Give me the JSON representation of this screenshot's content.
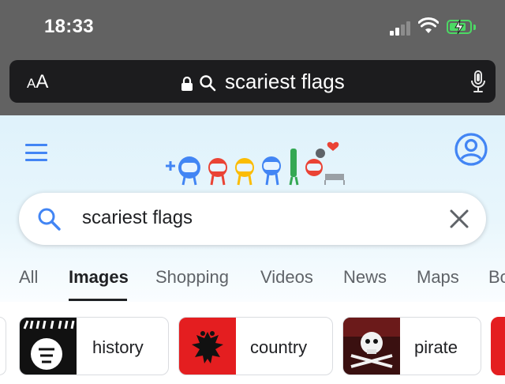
{
  "status_bar": {
    "time": "18:33",
    "signal_icon": "cellular-signal-icon",
    "wifi_icon": "wifi-icon",
    "battery_icon": "battery-charging-icon",
    "battery_color": "#4cd964"
  },
  "address_bar": {
    "text_size_label_small": "A",
    "text_size_label_big": "A",
    "lock_icon": "lock-icon",
    "search_icon": "search-icon",
    "query": "scariest flags",
    "mic_icon": "microphone-icon"
  },
  "header": {
    "menu_icon": "hamburger-menu-icon",
    "logo": "google-doodle-logo",
    "account_icon": "account-circle-icon",
    "accent_color": "#4285f4"
  },
  "search": {
    "query": "scariest flags",
    "search_icon": "search-icon",
    "clear_icon": "close-icon"
  },
  "tabs": [
    {
      "label": "All",
      "active": false
    },
    {
      "label": "Images",
      "active": true
    },
    {
      "label": "Shopping",
      "active": false
    },
    {
      "label": "Videos",
      "active": false
    },
    {
      "label": "News",
      "active": false
    },
    {
      "label": "Maps",
      "active": false
    },
    {
      "label": "Bo",
      "active": false
    }
  ],
  "chips": [
    {
      "label": "history",
      "thumb": "black-flag-thumbnail"
    },
    {
      "label": "country",
      "thumb": "albania-flag-thumbnail"
    },
    {
      "label": "pirate",
      "thumb": "pirate-flag-thumbnail"
    }
  ]
}
